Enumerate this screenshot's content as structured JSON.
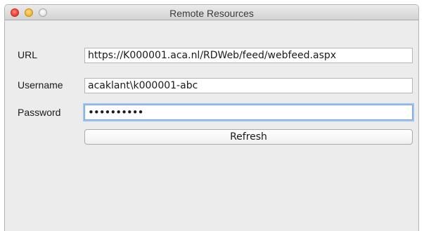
{
  "window": {
    "title": "Remote Resources"
  },
  "form": {
    "url_label": "URL",
    "url_value": "https://K000001.aca.nl/RDWeb/feed/webfeed.aspx",
    "username_label": "Username",
    "username_value": "acaklant\\k000001-abc",
    "password_label": "Password",
    "password_masked": "••••••••••",
    "refresh_label": "Refresh"
  },
  "icons": {
    "close": "close-icon",
    "minimize": "minimize-icon",
    "zoom": "zoom-icon"
  },
  "colors": {
    "close": "#f2453b",
    "minimize": "#f5b93c",
    "zoom": "#e3e3e3",
    "focus_ring": "#9fc3f0"
  }
}
